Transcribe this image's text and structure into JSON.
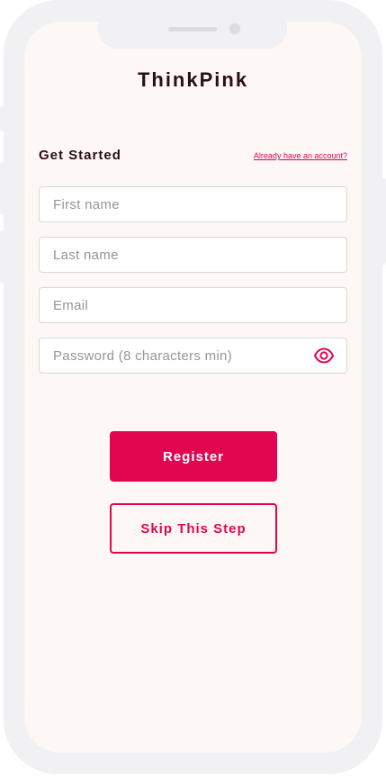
{
  "app": {
    "title": "ThinkPink"
  },
  "form": {
    "heading": "Get Started",
    "login_link": "Already have an account?",
    "first_name": {
      "placeholder": "First name",
      "value": ""
    },
    "last_name": {
      "placeholder": "Last name",
      "value": ""
    },
    "email": {
      "placeholder": "Email",
      "value": ""
    },
    "password": {
      "placeholder": "Password (8 characters min)",
      "value": "",
      "toggle_icon": "eye-icon"
    }
  },
  "actions": {
    "register_label": "Register",
    "skip_label": "Skip This Step"
  },
  "colors": {
    "accent": "#e1064f",
    "title_text": "#2b0f12",
    "screen_background": "#fdf7f6",
    "frame": "#f1f0f3"
  }
}
